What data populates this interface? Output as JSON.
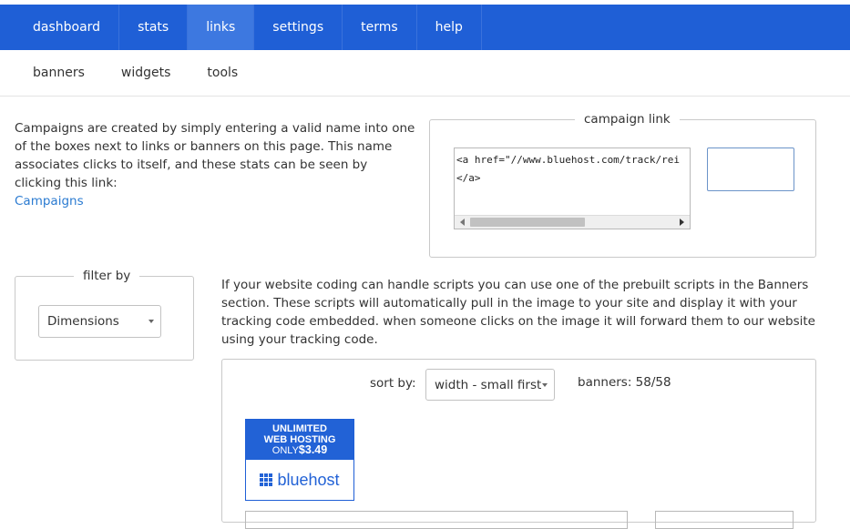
{
  "nav": {
    "tabs": [
      {
        "label": "dashboard"
      },
      {
        "label": "stats"
      },
      {
        "label": "links",
        "active": true
      },
      {
        "label": "settings"
      },
      {
        "label": "terms"
      },
      {
        "label": "help"
      }
    ],
    "subtabs": [
      {
        "label": "banners"
      },
      {
        "label": "widgets"
      },
      {
        "label": "tools"
      }
    ]
  },
  "intro": {
    "text": "Campaigns are created by simply entering a valid name into one of the boxes next to links or banners on this page. This name associates clicks to itself, and these stats can be seen by clicking this link:",
    "link_label": "Campaigns"
  },
  "campaign": {
    "legend": "campaign link",
    "code_line1": "<a href=\"//www.bluehost.com/track/rei",
    "code_line2": "</a>",
    "input_value": ""
  },
  "filter": {
    "legend": "filter by",
    "selected": "Dimensions"
  },
  "scripts_text": "If your website coding can handle scripts you can use one of the prebuilt scripts in the Banners section. These scripts will automatically pull in the image to your site and display it with your tracking code embedded. when someone clicks on the image it will forward them to our website using your tracking code.",
  "banners": {
    "sort_label": "sort by:",
    "sort_selected": "width - small first",
    "count": "banners: 58/58",
    "ad": {
      "line1": "UNLIMITED",
      "line2": "WEB HOSTING",
      "only": "ONLY",
      "price": "$3.49",
      "brand": "bluehost"
    }
  },
  "colors": {
    "nav_bg": "#1f5fd6",
    "nav_active": "#3d78e0",
    "link": "#2b7bd1",
    "brand_blue": "#2262d6"
  }
}
